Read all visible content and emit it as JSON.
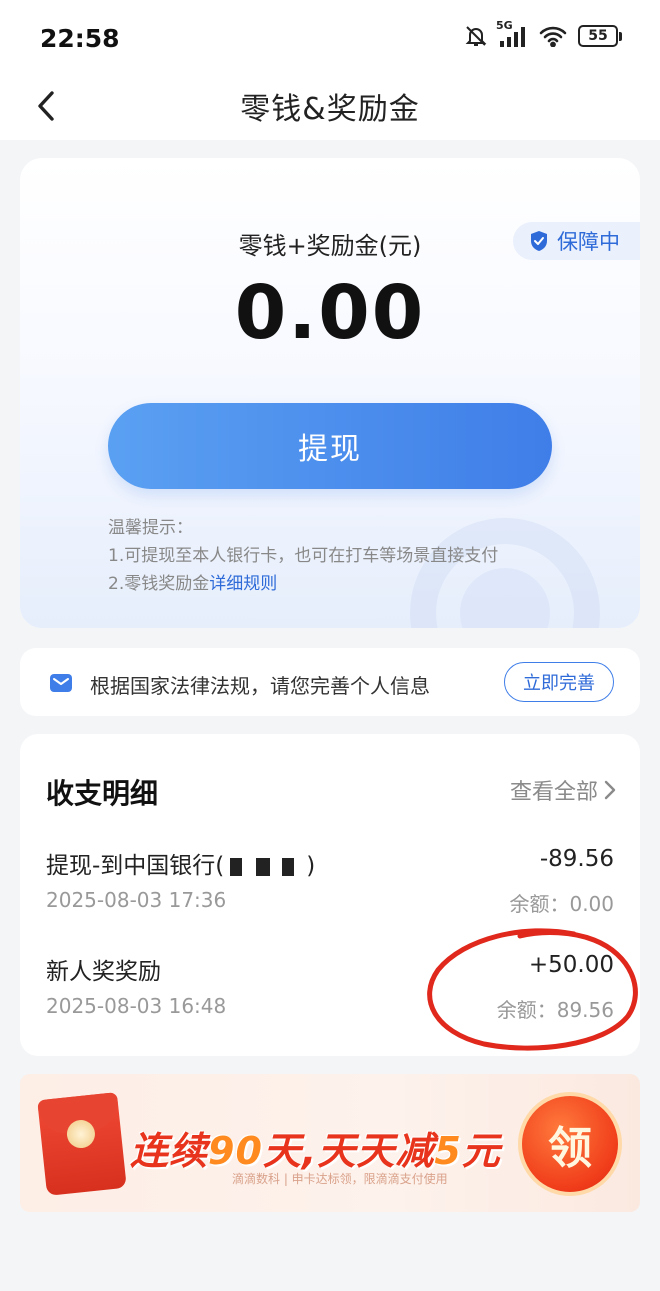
{
  "status_bar": {
    "time": "22:58",
    "network": "5G",
    "battery": "55"
  },
  "nav": {
    "title": "零钱&奖励金"
  },
  "balance": {
    "label": "零钱+奖励金(元)",
    "amount": "0.00",
    "guard_badge": "保障中",
    "withdraw_label": "提现",
    "tips_title": "温馨提示：",
    "tip1": "1.可提现至本人银行卡，也可在打车等场景直接支付",
    "tip2_prefix": "2.零钱奖励金",
    "tip2_link": "详细规则"
  },
  "notice": {
    "text": "根据国家法律法规，请您完善个人信息",
    "button": "立即完善"
  },
  "transactions": {
    "title": "收支明细",
    "view_all": "查看全部",
    "items": [
      {
        "name_prefix": "提现-到中国银行(",
        "name_suffix": ")",
        "time": "2025-08-03 17:36",
        "amount": "-89.56",
        "balance": "余额：0.00"
      },
      {
        "name": "新人奖奖励",
        "time": "2025-08-03 16:48",
        "amount": "+50.00",
        "balance": "余额：89.56"
      }
    ]
  },
  "promo": {
    "text_a": "连续",
    "text_b": "90",
    "text_c": "天,天天减",
    "text_d": "5",
    "text_e": "元",
    "sub": "滴滴数科 | 申卡达标领，限滴滴支付使用",
    "claim": "领"
  },
  "colors": {
    "accent": "#3f7ee8",
    "link": "#2f6bd8",
    "promo_red": "#e8341c",
    "annotation_red": "#e0281c"
  }
}
